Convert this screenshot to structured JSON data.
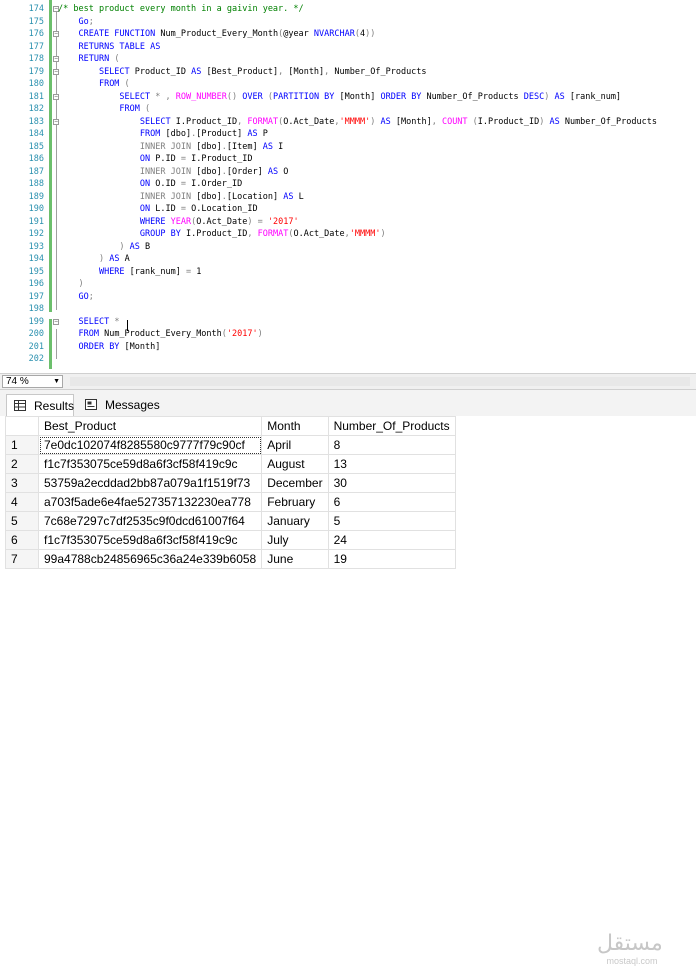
{
  "editor": {
    "lines": [
      {
        "n": "174",
        "fold": "minus",
        "tokens": [
          [
            "cm",
            "/* best product every month in a gaivin year. */"
          ]
        ]
      },
      {
        "n": "175",
        "tokens": [
          [
            "id",
            "    "
          ],
          [
            "kw",
            "Go"
          ],
          [
            "op",
            ";"
          ]
        ]
      },
      {
        "n": "176",
        "fold": "minus",
        "tokens": [
          [
            "id",
            "    "
          ],
          [
            "kw",
            "CREATE FUNCTION "
          ],
          [
            "id",
            "Num_Product_Every_Month"
          ],
          [
            "op",
            "("
          ],
          [
            "id",
            "@year "
          ],
          [
            "kw",
            "NVARCHAR"
          ],
          [
            "op",
            "("
          ],
          [
            "id",
            "4"
          ],
          [
            "op",
            "))"
          ]
        ]
      },
      {
        "n": "177",
        "tokens": [
          [
            "id",
            "    "
          ],
          [
            "kw",
            "RETURNS TABLE AS"
          ]
        ]
      },
      {
        "n": "178",
        "fold": "minus",
        "tokens": [
          [
            "id",
            "    "
          ],
          [
            "kw",
            "RETURN "
          ],
          [
            "op",
            "("
          ]
        ]
      },
      {
        "n": "179",
        "fold": "minus",
        "tokens": [
          [
            "id",
            "        "
          ],
          [
            "kw",
            "SELECT "
          ],
          [
            "id",
            "Product_ID "
          ],
          [
            "kw",
            "AS "
          ],
          [
            "id",
            "[Best_Product]"
          ],
          [
            "op",
            ", "
          ],
          [
            "id",
            "[Month]"
          ],
          [
            "op",
            ", "
          ],
          [
            "id",
            "Number_Of_Products"
          ]
        ]
      },
      {
        "n": "180",
        "tokens": [
          [
            "id",
            "        "
          ],
          [
            "kw",
            "FROM "
          ],
          [
            "op",
            "("
          ]
        ]
      },
      {
        "n": "181",
        "fold": "minus",
        "tokens": [
          [
            "id",
            "            "
          ],
          [
            "kw",
            "SELECT "
          ],
          [
            "op",
            "* , "
          ],
          [
            "fn",
            "ROW_NUMBER"
          ],
          [
            "op",
            "() "
          ],
          [
            "kw",
            "OVER "
          ],
          [
            "op",
            "("
          ],
          [
            "kw",
            "PARTITION BY "
          ],
          [
            "id",
            "[Month] "
          ],
          [
            "kw",
            "ORDER BY "
          ],
          [
            "id",
            "Number_Of_Products "
          ],
          [
            "kw",
            "DESC"
          ],
          [
            "op",
            ") "
          ],
          [
            "kw",
            "AS "
          ],
          [
            "id",
            "[rank_num]"
          ]
        ]
      },
      {
        "n": "182",
        "tokens": [
          [
            "id",
            "            "
          ],
          [
            "kw",
            "FROM "
          ],
          [
            "op",
            "("
          ]
        ]
      },
      {
        "n": "183",
        "fold": "minus",
        "tokens": [
          [
            "id",
            "                "
          ],
          [
            "kw",
            "SELECT "
          ],
          [
            "id",
            "I.Product_ID"
          ],
          [
            "op",
            ", "
          ],
          [
            "fn",
            "FORMAT"
          ],
          [
            "op",
            "("
          ],
          [
            "id",
            "O.Act_Date"
          ],
          [
            "op",
            ","
          ],
          [
            "st",
            "'MMMM'"
          ],
          [
            "op",
            ") "
          ],
          [
            "kw",
            "AS "
          ],
          [
            "id",
            "[Month]"
          ],
          [
            "op",
            ", "
          ],
          [
            "fn",
            "COUNT "
          ],
          [
            "op",
            "("
          ],
          [
            "id",
            "I.Product_ID"
          ],
          [
            "op",
            ") "
          ],
          [
            "kw",
            "AS "
          ],
          [
            "id",
            "Number_Of_Products"
          ]
        ]
      },
      {
        "n": "184",
        "tokens": [
          [
            "id",
            "                "
          ],
          [
            "kw",
            "FROM "
          ],
          [
            "id",
            "[dbo]"
          ],
          [
            "op",
            "."
          ],
          [
            "id",
            "[Product] "
          ],
          [
            "kw",
            "AS "
          ],
          [
            "id",
            "P"
          ]
        ]
      },
      {
        "n": "185",
        "tokens": [
          [
            "id",
            "                "
          ],
          [
            "op",
            "INNER JOIN "
          ],
          [
            "id",
            "[dbo]"
          ],
          [
            "op",
            "."
          ],
          [
            "id",
            "[Item] "
          ],
          [
            "kw",
            "AS "
          ],
          [
            "id",
            "I"
          ]
        ]
      },
      {
        "n": "186",
        "tokens": [
          [
            "id",
            "                "
          ],
          [
            "kw",
            "ON "
          ],
          [
            "id",
            "P.ID "
          ],
          [
            "op",
            "= "
          ],
          [
            "id",
            "I.Product_ID"
          ]
        ]
      },
      {
        "n": "187",
        "tokens": [
          [
            "id",
            "                "
          ],
          [
            "op",
            "INNER JOIN "
          ],
          [
            "id",
            "[dbo]"
          ],
          [
            "op",
            "."
          ],
          [
            "id",
            "[Order] "
          ],
          [
            "kw",
            "AS "
          ],
          [
            "id",
            "O"
          ]
        ]
      },
      {
        "n": "188",
        "tokens": [
          [
            "id",
            "                "
          ],
          [
            "kw",
            "ON "
          ],
          [
            "id",
            "O.ID "
          ],
          [
            "op",
            "= "
          ],
          [
            "id",
            "I.Order_ID"
          ]
        ]
      },
      {
        "n": "189",
        "tokens": [
          [
            "id",
            "                "
          ],
          [
            "op",
            "INNER JOIN "
          ],
          [
            "id",
            "[dbo]"
          ],
          [
            "op",
            "."
          ],
          [
            "id",
            "[Location] "
          ],
          [
            "kw",
            "AS "
          ],
          [
            "id",
            "L"
          ]
        ]
      },
      {
        "n": "190",
        "tokens": [
          [
            "id",
            "                "
          ],
          [
            "kw",
            "ON "
          ],
          [
            "id",
            "L.ID "
          ],
          [
            "op",
            "= "
          ],
          [
            "id",
            "O.Location_ID"
          ]
        ]
      },
      {
        "n": "191",
        "tokens": [
          [
            "id",
            "                "
          ],
          [
            "kw",
            "WHERE "
          ],
          [
            "fn",
            "YEAR"
          ],
          [
            "op",
            "("
          ],
          [
            "id",
            "O.Act_Date"
          ],
          [
            "op",
            ") = "
          ],
          [
            "st",
            "'2017'"
          ]
        ]
      },
      {
        "n": "192",
        "tokens": [
          [
            "id",
            "                "
          ],
          [
            "kw",
            "GROUP BY "
          ],
          [
            "id",
            "I.Product_ID"
          ],
          [
            "op",
            ", "
          ],
          [
            "fn",
            "FORMAT"
          ],
          [
            "op",
            "("
          ],
          [
            "id",
            "O.Act_Date"
          ],
          [
            "op",
            ","
          ],
          [
            "st",
            "'MMMM'"
          ],
          [
            "op",
            ")"
          ]
        ]
      },
      {
        "n": "193",
        "tokens": [
          [
            "id",
            "            "
          ],
          [
            "op",
            ") "
          ],
          [
            "kw",
            "AS "
          ],
          [
            "id",
            "B"
          ]
        ]
      },
      {
        "n": "194",
        "tokens": [
          [
            "id",
            "        "
          ],
          [
            "op",
            ") "
          ],
          [
            "kw",
            "AS "
          ],
          [
            "id",
            "A"
          ]
        ]
      },
      {
        "n": "195",
        "tokens": [
          [
            "id",
            "        "
          ],
          [
            "kw",
            "WHERE "
          ],
          [
            "id",
            "[rank_num] "
          ],
          [
            "op",
            "= "
          ],
          [
            "id",
            "1"
          ]
        ]
      },
      {
        "n": "196",
        "tokens": [
          [
            "id",
            "    "
          ],
          [
            "op",
            ")"
          ]
        ]
      },
      {
        "n": "197",
        "tokens": [
          [
            "id",
            "    "
          ],
          [
            "kw",
            "GO"
          ],
          [
            "op",
            ";"
          ]
        ]
      },
      {
        "n": "198",
        "tokens": []
      },
      {
        "n": "199",
        "fold": "minus",
        "tokens": [
          [
            "id",
            "    "
          ],
          [
            "kw",
            "SELECT "
          ],
          [
            "op",
            "* "
          ]
        ]
      },
      {
        "n": "200",
        "tokens": [
          [
            "id",
            "    "
          ],
          [
            "kw",
            "FROM "
          ],
          [
            "id",
            "Num_Product_Every_Month"
          ],
          [
            "op",
            "("
          ],
          [
            "st",
            "'2017'"
          ],
          [
            "op",
            ")"
          ]
        ]
      },
      {
        "n": "201",
        "tokens": [
          [
            "id",
            "    "
          ],
          [
            "kw",
            "ORDER BY "
          ],
          [
            "id",
            "[Month]"
          ]
        ]
      },
      {
        "n": "202",
        "tokens": []
      }
    ]
  },
  "zoom": {
    "value": "74 %"
  },
  "tabs": {
    "results": "Results",
    "messages": "Messages"
  },
  "grid": {
    "columns": [
      "",
      "Best_Product",
      "Month",
      "Number_Of_Products"
    ],
    "rows": [
      [
        "1",
        "7e0dc102074f8285580c9777f79c90cf",
        "April",
        "8"
      ],
      [
        "2",
        "f1c7f353075ce59d8a6f3cf58f419c9c",
        "August",
        "13"
      ],
      [
        "3",
        "53759a2ecddad2bb87a079a1f1519f73",
        "December",
        "30"
      ],
      [
        "4",
        "a703f5ade6e4fae527357132230ea778",
        "February",
        "6"
      ],
      [
        "5",
        "7c68e7297c7df2535c9f0dcd61007f64",
        "January",
        "5"
      ],
      [
        "6",
        "f1c7f353075ce59d8a6f3cf58f419c9c",
        "July",
        "24"
      ],
      [
        "7",
        "99a4788cb24856965c36a24e339b6058",
        "June",
        "19"
      ]
    ]
  },
  "watermark": {
    "arabic": "مستقل",
    "latin": "mostaql.com"
  },
  "colors": {
    "keyword": "#0000ff",
    "function": "#ff00ff",
    "string": "#ff0000",
    "comment": "#008000",
    "lineNumber": "#2b91af"
  }
}
